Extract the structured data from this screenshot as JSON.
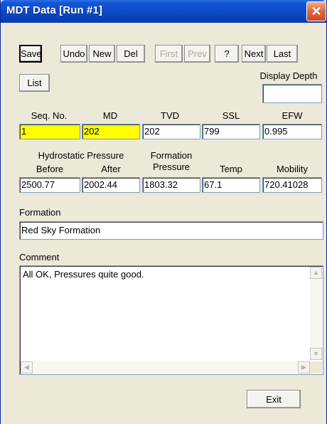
{
  "window": {
    "title": "MDT Data [Run #1]",
    "close_glyph": "✕"
  },
  "toolbar": {
    "save": "Save",
    "undo": "Undo",
    "new": "New",
    "del": "Del",
    "first": "First",
    "prev": "Prev",
    "help": "?",
    "next": "Next",
    "last": "Last",
    "list": "List"
  },
  "display_depth": {
    "label": "Display Depth",
    "value": ""
  },
  "row1": {
    "labels": {
      "seq": "Seq. No.",
      "md": "MD",
      "tvd": "TVD",
      "ssl": "SSL",
      "efw": "EFW"
    },
    "values": {
      "seq": "1",
      "md": "202",
      "tvd": "202",
      "ssl": "799",
      "efw": "0.995"
    }
  },
  "row2": {
    "labels": {
      "hydro_header": "Hydrostatic Pressure",
      "before": "Before",
      "after": "After",
      "formation_line1": "Formation",
      "formation_line2": "Pressure",
      "temp": "Temp",
      "mobility": "Mobility"
    },
    "values": {
      "before": "2500.77",
      "after": "2002.44",
      "formation_pressure": "1803.32",
      "temp": "67.1",
      "mobility": "720.41028"
    }
  },
  "formation": {
    "label": "Formation",
    "value": "Red Sky Formation"
  },
  "comment": {
    "label": "Comment",
    "value": "All OK, Pressures quite good."
  },
  "exit": "Exit",
  "colors": {
    "highlight_field": "#ffff00",
    "title_bar": "#0a4ac6",
    "dialog_bg": "#ece9d8"
  }
}
